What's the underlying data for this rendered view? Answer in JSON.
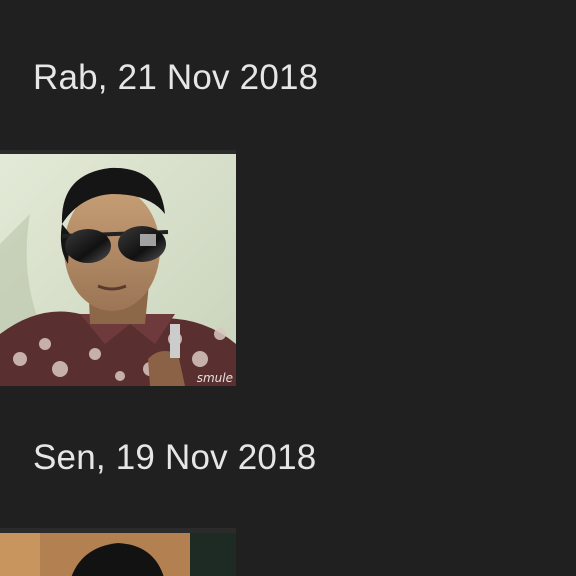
{
  "timeline": {
    "groups": [
      {
        "date_label": "Rab, 21 Nov 2018",
        "photo": {
          "subject": "man-with-aviator-sunglasses",
          "watermark": "smule"
        }
      },
      {
        "date_label": "Sen, 19 Nov 2018",
        "photo": {
          "subject": "man-portrait-partial"
        }
      }
    ]
  },
  "colors": {
    "background": "#202020",
    "text": "#e6e6e6"
  }
}
